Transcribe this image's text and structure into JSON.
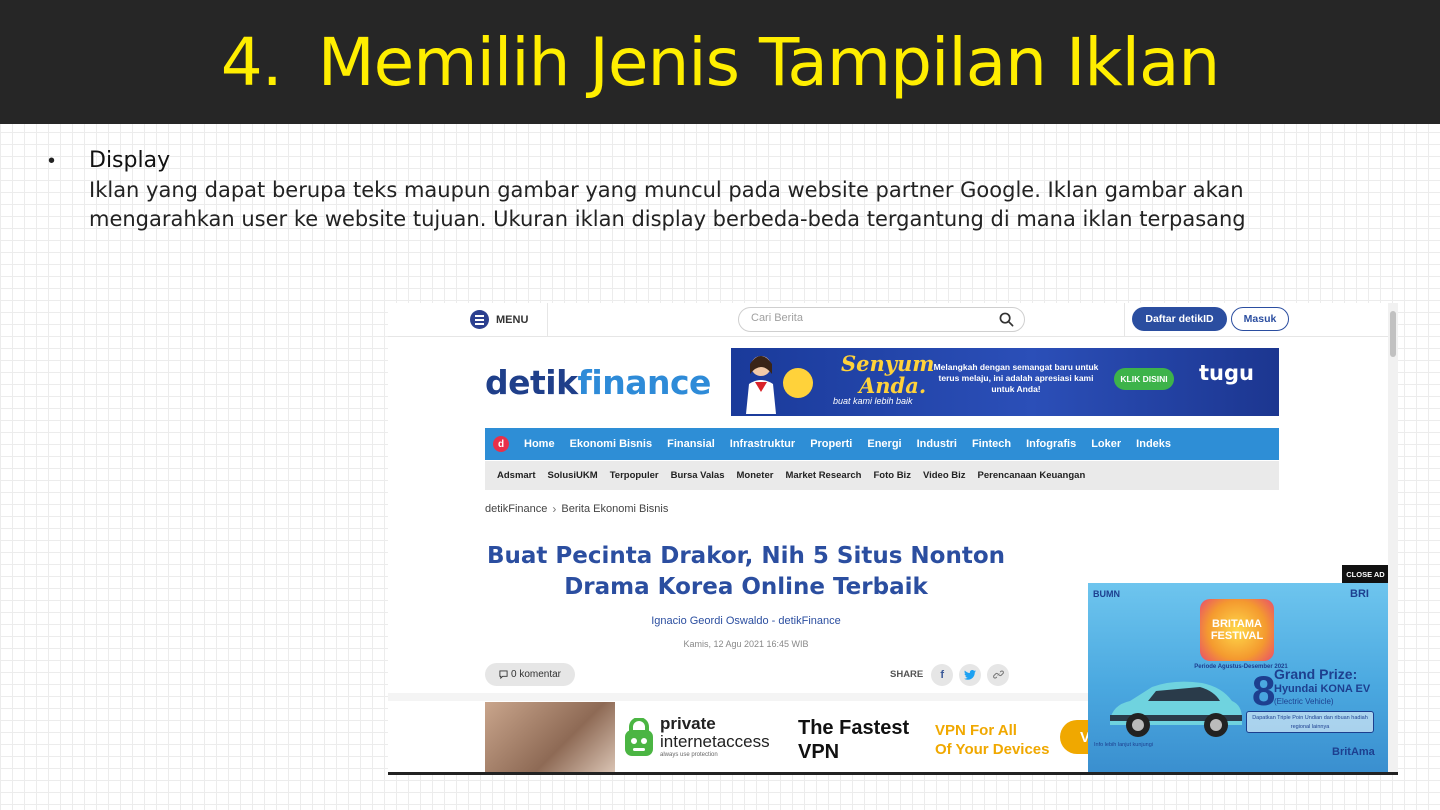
{
  "slide": {
    "title_number": "4.",
    "title_text": "Memilih Jenis Tampilan Iklan",
    "bullet_symbol": "•",
    "bullet_heading": "Display",
    "bullet_body": "Iklan yang dapat berupa teks maupun gambar yang muncul pada website partner Google. Iklan gambar akan mengarahkan user ke website tujuan. Ukuran iklan display berbeda-beda tergantung di mana iklan terpasang"
  },
  "colors": {
    "title_bg": "#262626",
    "title_fg": "#ffee00",
    "detik_blue": "#2e8ed6",
    "detik_dark": "#2b4ea0"
  },
  "site": {
    "menu_label": "MENU",
    "search_placeholder": "Cari Berita",
    "register_label": "Daftar detikID",
    "login_label": "Masuk",
    "logo_part1": "detik",
    "logo_part2": "finance",
    "nav_logo": "d",
    "nav": [
      "Home",
      "Ekonomi Bisnis",
      "Finansial",
      "Infrastruktur",
      "Properti",
      "Energi",
      "Industri",
      "Fintech",
      "Infografis",
      "Loker",
      "Indeks"
    ],
    "subnav": [
      "Adsmart",
      "SolusiUKM",
      "Terpopuler",
      "Bursa Valas",
      "Moneter",
      "Market Research",
      "Foto Biz",
      "Video Biz",
      "Perencanaan Keuangan"
    ],
    "breadcrumb": [
      "detikFinance",
      "Berita Ekonomi Bisnis"
    ],
    "breadcrumb_sep": "›",
    "headline": "Buat Pecinta Drakor, Nih 5 Situs Nonton Drama Korea Online Terbaik",
    "author": "Ignacio Geordi Oswaldo - detikFinance",
    "date": "Kamis, 12 Agu 2021 16:45 WIB",
    "comment_count": "0 komentar",
    "share_label": "SHARE"
  },
  "banner_ad": {
    "headline1": "Senyum",
    "headline2": "Anda.",
    "tagline": "buat kami lebih baik",
    "copy": "Melangkah dengan semangat baru untuk terus melaju, ini adalah apresiasi kami untuk Anda!",
    "cta": "KLIK DISINI",
    "brand": "tugu"
  },
  "bottom_ad": {
    "brand_line1": "private",
    "brand_line2": "internetaccess",
    "brand_tag": "always use protection",
    "headline_1": "The Fastest",
    "headline_2": "VPN",
    "sub_1": "VPN For All",
    "sub_2": "Of Your Devices",
    "button_text": "V"
  },
  "side_ad": {
    "close_label": "CLOSE AD",
    "bumn": "BUMN",
    "bri": "BRI",
    "fest_text": "BRITAMA FESTIVAL",
    "period": "Periode Agustus-Desember 2021",
    "prize_num": "8",
    "prize_title": "Grand Prize:",
    "prize_model": "Hyundai KONA EV",
    "prize_type": "(Electric Vehicle)",
    "prize_note": "Dapatkan Triple Poin Undian dan ribuan hadiah regional lainnya",
    "footer": "Info lebih lanjut kunjungi",
    "britama": "BritAma"
  }
}
